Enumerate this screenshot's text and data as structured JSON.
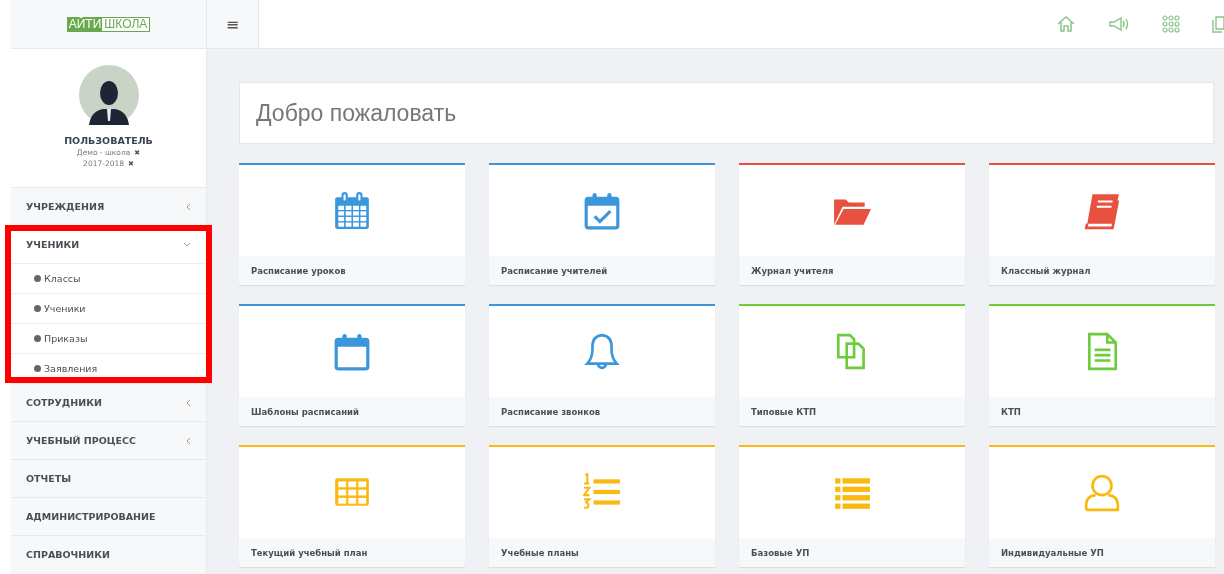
{
  "logo": {
    "part_1": "АЙТИ",
    "part_2": "ШКОЛА"
  },
  "menu_button": "≡",
  "user": {
    "name": "ПОЛЬЗОВАТЕЛЬ",
    "school": "Демо - школа",
    "year": "2017-2018",
    "remove_icon": "✖"
  },
  "sidebar": {
    "items": [
      {
        "label": "УЧРЕЖДЕНИЯ",
        "expandable": true,
        "expanded": false,
        "highlighted": false
      },
      {
        "label": "УЧЕНИКИ",
        "expandable": true,
        "expanded": true,
        "highlighted": true,
        "children": [
          {
            "label": "Классы"
          },
          {
            "label": "Ученики"
          },
          {
            "label": "Приказы"
          },
          {
            "label": "Заявления"
          }
        ]
      },
      {
        "label": "СОТРУДНИКИ",
        "expandable": true,
        "expanded": false,
        "highlighted": false
      },
      {
        "label": "УЧЕБНЫЙ ПРОЦЕСС",
        "expandable": true,
        "expanded": false,
        "highlighted": false
      },
      {
        "label": "ОТЧЕТЫ",
        "expandable": false,
        "expanded": false,
        "highlighted": false
      },
      {
        "label": "АДМИНИСТРИРОВАНИЕ",
        "expandable": false,
        "expanded": false,
        "highlighted": false
      },
      {
        "label": "СПРАВОЧНИКИ",
        "expandable": false,
        "expanded": false,
        "highlighted": false
      }
    ]
  },
  "welcome": "Добро пожаловать",
  "tiles": [
    {
      "label": "Расписание уроков",
      "kind": "calendar-grid",
      "color": "#3a97dc"
    },
    {
      "label": "Расписание учителей",
      "kind": "calendar-check",
      "color": "#3a97dc"
    },
    {
      "label": "Журнал учителя",
      "kind": "folder",
      "color": "#e8503f"
    },
    {
      "label": "Классный журнал",
      "kind": "book",
      "color": "#e8503f"
    },
    {
      "label": "Шаблоны расписаний",
      "kind": "calendar-blank",
      "color": "#3a97dc"
    },
    {
      "label": "Расписание звонков",
      "kind": "bell",
      "color": "#3a97dc"
    },
    {
      "label": "Типовые КТП",
      "kind": "copy",
      "color": "#6ccc3c"
    },
    {
      "label": "КТП",
      "kind": "document",
      "color": "#6ccc3c"
    },
    {
      "label": "Текущий учебный план",
      "kind": "table",
      "color": "#f9b90f"
    },
    {
      "label": "Учебные планы",
      "kind": "numbered-list",
      "color": "#f9b90f"
    },
    {
      "label": "Базовые УП",
      "kind": "list",
      "color": "#f9b90f"
    },
    {
      "label": "Индивидуальные УП",
      "kind": "user",
      "color": "#f9b90f"
    }
  ]
}
